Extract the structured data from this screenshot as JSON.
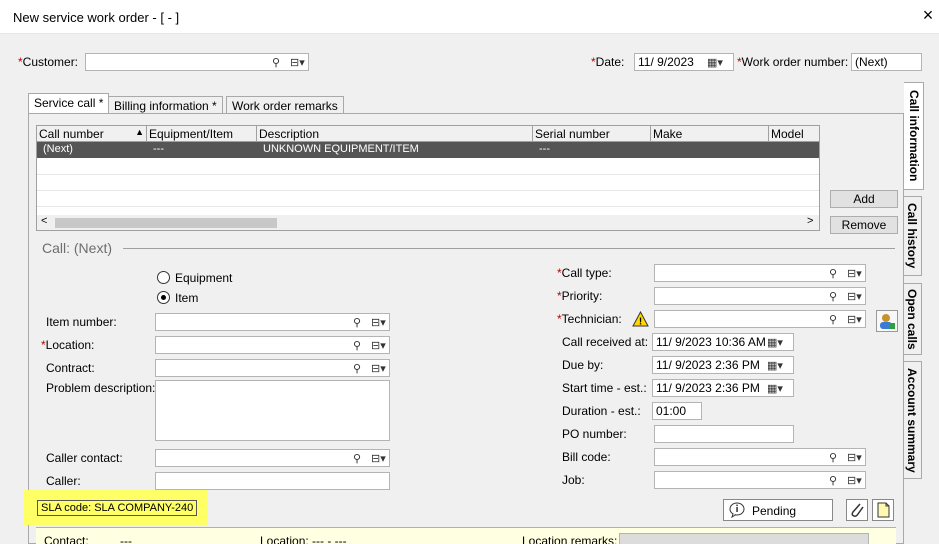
{
  "window": {
    "title": "New service work order - [ - ]",
    "close_glyph": "×"
  },
  "header": {
    "customer_label": "Customer:",
    "customer_value": "",
    "date_label": "Date:",
    "date_value": "11/ 9/2023",
    "wo_number_label": "Work order number:",
    "wo_number_value": "(Next)"
  },
  "tabs": [
    {
      "label": "Service call *"
    },
    {
      "label": "Billing information  *"
    },
    {
      "label": "Work order remarks"
    }
  ],
  "side_tabs": [
    {
      "label": "Call information"
    },
    {
      "label": "Call history"
    },
    {
      "label": "Open calls"
    },
    {
      "label": "Account summary"
    }
  ],
  "grid": {
    "columns": [
      "Call number",
      "Equipment/Item",
      "Description",
      "Serial number",
      "Make",
      "Model"
    ],
    "rows": [
      [
        "(Next)",
        "---",
        "UNKNOWN EQUIPMENT/ITEM",
        "---",
        "",
        ""
      ]
    ],
    "add_label": "Add",
    "remove_label": "Remove"
  },
  "call": {
    "group_title": "Call: (Next)",
    "equipment_label": "Equipment",
    "item_label": "Item",
    "item_number_label": "Item number:",
    "location_label": "Location:",
    "contract_label": "Contract:",
    "problem_label": "Problem description:",
    "caller_contact_label": "Caller contact:",
    "caller_label": "Caller:",
    "call_type_label": "Call type:",
    "priority_label": "Priority:",
    "technician_label": "Technician:",
    "call_received_label": "Call received at:",
    "call_received_value": "11/ 9/2023 10:36 AM",
    "due_by_label": "Due by:",
    "due_by_value": "11/ 9/2023   2:36 PM",
    "start_time_label": "Start time - est.:",
    "start_time_value": "11/ 9/2023   2:36 PM",
    "duration_label": "Duration - est.:",
    "duration_value": "01:00",
    "po_label": "PO number:",
    "bill_code_label": "Bill code:",
    "job_label": "Job:"
  },
  "sla": {
    "text": "SLA code: SLA COMPANY-240"
  },
  "pending": {
    "label": "Pending"
  },
  "footer": {
    "contact_label": "Contact:",
    "contact_value": "---",
    "location_label": "Location:",
    "location_value": "--- - ---",
    "remarks_label": "Location remarks:"
  },
  "icons": {
    "lookup": "⚲",
    "dropdown": "⊟▾",
    "calendar": "▦▾",
    "warning": "!",
    "scroll_left": "<",
    "scroll_right": ">",
    "sort_up": "▲"
  },
  "colors": {
    "selected_row": "#555555",
    "sla_highlight": "#ffff66",
    "required": "#c00000"
  }
}
